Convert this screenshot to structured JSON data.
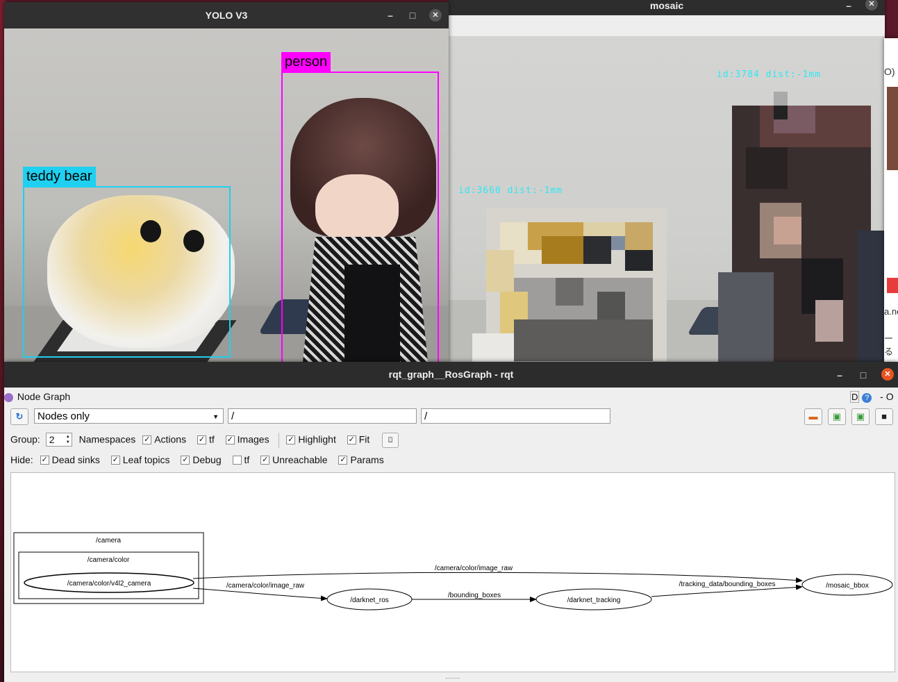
{
  "yolo_window": {
    "title": "YOLO V3",
    "minimize": "–",
    "maximize": "□",
    "close": "✕",
    "detections": [
      {
        "label": "teddy bear",
        "color": "#1fd0f0"
      },
      {
        "label": "person",
        "color": "#ff00ff"
      }
    ]
  },
  "mosaic_window": {
    "title": "mosaic",
    "minimize": "–",
    "close": "✕",
    "tracks": [
      {
        "text": "id:3784  dist:-1mm"
      },
      {
        "text": "id:3660  dist:-1mm"
      }
    ]
  },
  "edge_window": {
    "fragments": [
      "O)",
      "a.ne",
      "ーる"
    ]
  },
  "rqt_window": {
    "title": "rqt_graph__RosGraph - rqt",
    "minimize": "–",
    "maximize": "□",
    "close": "✕",
    "plugin_title": "Node Graph",
    "plugin_right": "D",
    "plugin_help": "?",
    "plugin_dash": "- O",
    "mode_select": "Nodes only",
    "filter1": "/",
    "filter2": "/",
    "group_label": "Group:",
    "group_value": "2",
    "group_options": [
      {
        "label": "Namespaces",
        "checked": false
      },
      {
        "label": "Actions",
        "checked": true
      },
      {
        "label": "tf",
        "checked": true
      },
      {
        "label": "Images",
        "checked": true
      },
      {
        "label": "Highlight",
        "checked": true
      },
      {
        "label": "Fit",
        "checked": true
      }
    ],
    "hide_label": "Hide:",
    "hide_options": [
      {
        "label": "Dead sinks",
        "checked": true
      },
      {
        "label": "Leaf topics",
        "checked": true
      },
      {
        "label": "Debug",
        "checked": true
      },
      {
        "label": "tf",
        "checked": false
      },
      {
        "label": "Unreachable",
        "checked": true
      },
      {
        "label": "Params",
        "checked": true
      }
    ],
    "graph": {
      "clusters": [
        "/camera",
        "/camera/color"
      ],
      "nodes": [
        "/camera/color/v4l2_camera",
        "/darknet_ros",
        "/darknet_tracking",
        "/mosaic_bbox"
      ],
      "edges": [
        {
          "from": "/camera/color/v4l2_camera",
          "to": "/mosaic_bbox",
          "label": "/camera/color/image_raw"
        },
        {
          "from": "/camera/color/v4l2_camera",
          "to": "/darknet_ros",
          "label": "/camera/color/image_raw"
        },
        {
          "from": "/darknet_ros",
          "to": "/darknet_tracking",
          "label": "/bounding_boxes"
        },
        {
          "from": "/darknet_tracking",
          "to": "/mosaic_bbox",
          "label": "/tracking_data/bounding_boxes"
        }
      ]
    }
  }
}
